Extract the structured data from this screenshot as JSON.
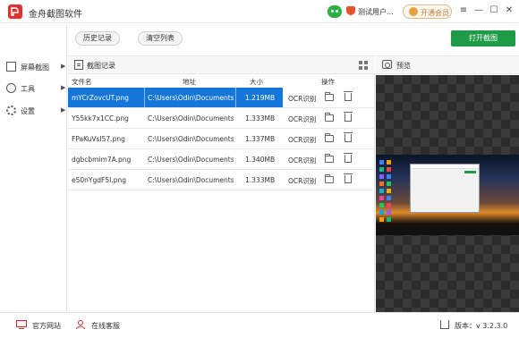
{
  "app": {
    "title": "金舟截图软件",
    "user_name": "测试用户...",
    "vip_label": "开通会员",
    "window_controls": [
      "≡",
      "—",
      "☐",
      "✕"
    ]
  },
  "sidebar": {
    "items": [
      {
        "label": "屏幕截图",
        "icon": "screenshot-icon"
      },
      {
        "label": "工具",
        "icon": "tools-icon"
      },
      {
        "label": "设置",
        "icon": "settings-icon"
      }
    ],
    "arrow": "▶"
  },
  "toolbar": {
    "history_label": "历史记录",
    "clear_label": "清空列表",
    "open_label": "打开截图"
  },
  "list": {
    "title": "截图记录",
    "columns": {
      "filename": "文件名",
      "path": "地址",
      "size": "大小",
      "action": "操作"
    },
    "rows": [
      {
        "filename": "mYCrZovcUT.png",
        "path": "C:\\Users\\Odin\\Documents\\...",
        "size": "1.219MB",
        "ocr": "OCR识别"
      },
      {
        "filename": "Y55kk7x1CC.png",
        "path": "C:\\Users\\Odin\\Documents\\...",
        "size": "1.333MB",
        "ocr": "OCR识别"
      },
      {
        "filename": "FPaKuVsI57.png",
        "path": "C:\\Users\\Odin\\Documents\\...",
        "size": "1.337MB",
        "ocr": "OCR识别"
      },
      {
        "filename": "dgbcbmim7A.png",
        "path": "C:\\Users\\Odin\\Documents\\...",
        "size": "1.340MB",
        "ocr": "OCR识别"
      },
      {
        "filename": "e50nYgdF5I.png",
        "path": "C:\\Users\\Odin\\Documents\\...",
        "size": "1.333MB",
        "ocr": "OCR识别"
      }
    ],
    "selected_index": 0
  },
  "preview": {
    "title": "预览"
  },
  "footer": {
    "website_label": "官方网站",
    "service_label": "在线客服",
    "version_label": "版本：v 3.2.3.0"
  },
  "colors": {
    "accent_green": "#1f9b47",
    "selection_blue": "#1476d8",
    "brand_red": "#e0332f"
  }
}
